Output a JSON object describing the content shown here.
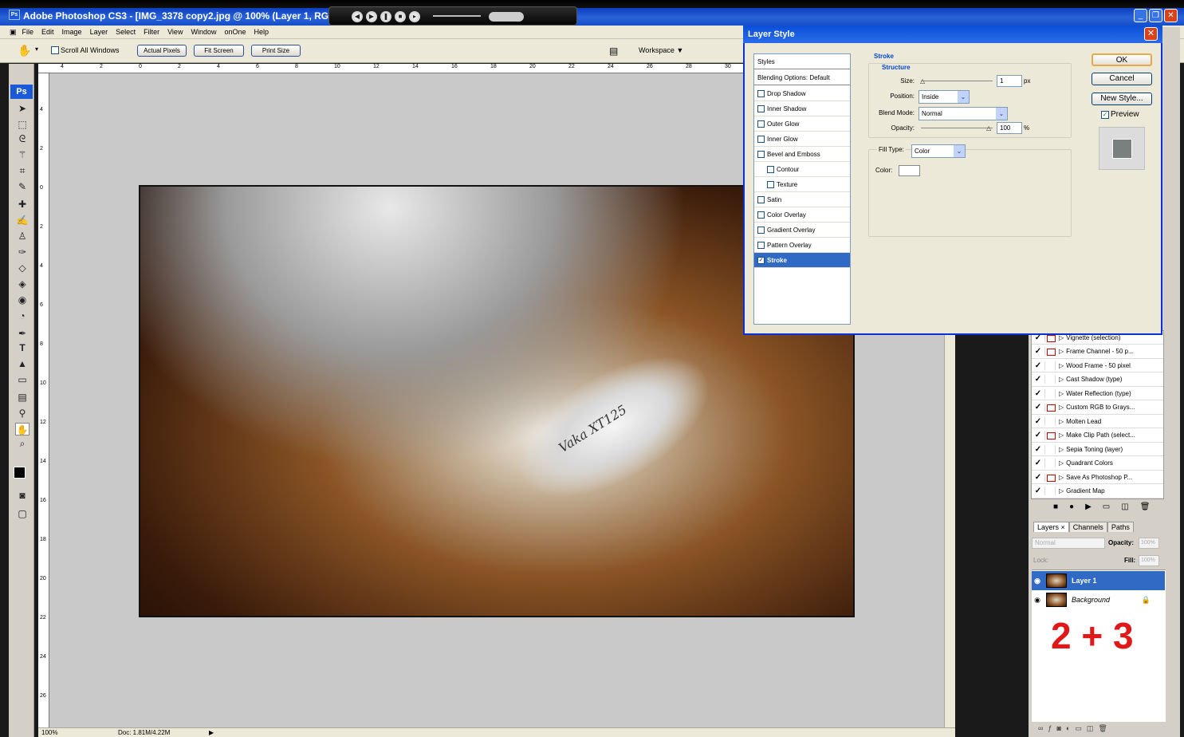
{
  "titlebar": {
    "app_icon": "Ps",
    "title": "Adobe Photoshop CS3 - [IMG_3378 copy2.jpg @ 100% (Layer 1, RGB/8)]",
    "media_icons": [
      "media-rewind-icon",
      "media-play-icon",
      "media-pause-icon",
      "media-stop-icon",
      "media-forward-icon"
    ]
  },
  "menubar": {
    "items": [
      "File",
      "Edit",
      "Image",
      "Layer",
      "Select",
      "Filter",
      "View",
      "Window",
      "onOne",
      "Help"
    ]
  },
  "options": {
    "scroll_all": "Scroll All Windows",
    "actual_pixels": "Actual Pixels",
    "fit_screen": "Fit Screen",
    "print_size": "Print Size",
    "workspace": "Workspace"
  },
  "toolbox": {
    "logo": "Ps"
  },
  "ruler_top": [
    "4",
    "2",
    "0",
    "2",
    "4",
    "6",
    "8",
    "10",
    "12",
    "14",
    "16",
    "18",
    "20",
    "22",
    "24",
    "26",
    "28",
    "30"
  ],
  "ruler_left": [
    "4",
    "2",
    "0",
    "2",
    "4",
    "6",
    "8",
    "10",
    "12",
    "14",
    "16",
    "18",
    "20",
    "22",
    "24",
    "26"
  ],
  "photo": {
    "bike_text": "Vaka XT125"
  },
  "statusbar": {
    "zoom": "100%",
    "doc": "Doc: 1.81M/4.22M"
  },
  "dialog": {
    "title": "Layer Style",
    "styles_header": "Styles",
    "blending_options": "Blending Options: Default",
    "effects": [
      {
        "label": "Drop Shadow",
        "checked": false,
        "indent": false,
        "selected": false
      },
      {
        "label": "Inner Shadow",
        "checked": false,
        "indent": false,
        "selected": false
      },
      {
        "label": "Outer Glow",
        "checked": false,
        "indent": false,
        "selected": false
      },
      {
        "label": "Inner Glow",
        "checked": false,
        "indent": false,
        "selected": false
      },
      {
        "label": "Bevel and Emboss",
        "checked": false,
        "indent": false,
        "selected": false
      },
      {
        "label": "Contour",
        "checked": false,
        "indent": true,
        "selected": false
      },
      {
        "label": "Texture",
        "checked": false,
        "indent": true,
        "selected": false
      },
      {
        "label": "Satin",
        "checked": false,
        "indent": false,
        "selected": false
      },
      {
        "label": "Color Overlay",
        "checked": false,
        "indent": false,
        "selected": false
      },
      {
        "label": "Gradient Overlay",
        "checked": false,
        "indent": false,
        "selected": false
      },
      {
        "label": "Pattern Overlay",
        "checked": false,
        "indent": false,
        "selected": false
      },
      {
        "label": "Stroke",
        "checked": true,
        "indent": false,
        "selected": true
      }
    ],
    "stroke_header": "Stroke",
    "structure_header": "Structure",
    "size_label": "Size:",
    "size_value": "1",
    "size_unit": "px",
    "position_label": "Position:",
    "position_value": "Inside",
    "blend_label": "Blend Mode:",
    "blend_value": "Normal",
    "opacity_label": "Opacity:",
    "opacity_value": "100",
    "opacity_unit": "%",
    "filltype_label": "Fill Type:",
    "filltype_value": "Color",
    "color_label": "Color:",
    "ok": "OK",
    "cancel": "Cancel",
    "new_style": "New Style...",
    "preview": "Preview"
  },
  "actions": {
    "items": [
      {
        "label": "Vignette (selection)",
        "dialog": true
      },
      {
        "label": "Frame Channel - 50 p...",
        "dialog": true
      },
      {
        "label": "Wood Frame - 50 pixel",
        "dialog": false
      },
      {
        "label": "Cast Shadow (type)",
        "dialog": false
      },
      {
        "label": "Water Reflection (type)",
        "dialog": false
      },
      {
        "label": "Custom RGB to Grays...",
        "dialog": true
      },
      {
        "label": "Molten Lead",
        "dialog": false
      },
      {
        "label": "Make Clip Path (select...",
        "dialog": true
      },
      {
        "label": "Sepia Toning (layer)",
        "dialog": false
      },
      {
        "label": "Quadrant Colors",
        "dialog": false
      },
      {
        "label": "Save As Photoshop P...",
        "dialog": true
      },
      {
        "label": "Gradient Map",
        "dialog": false
      }
    ]
  },
  "layers_panel": {
    "tabs": [
      "Layers ×",
      "Channels",
      "Paths"
    ],
    "blend_mode": "Normal",
    "opacity_label": "Opacity:",
    "opacity_value": "100%",
    "lock_label": "Lock:",
    "fill_label": "Fill:",
    "fill_value": "100%",
    "layers": [
      {
        "name": "Layer 1",
        "selected": true
      },
      {
        "name": "Background",
        "selected": false
      }
    ],
    "annotation": "2 + 3"
  }
}
